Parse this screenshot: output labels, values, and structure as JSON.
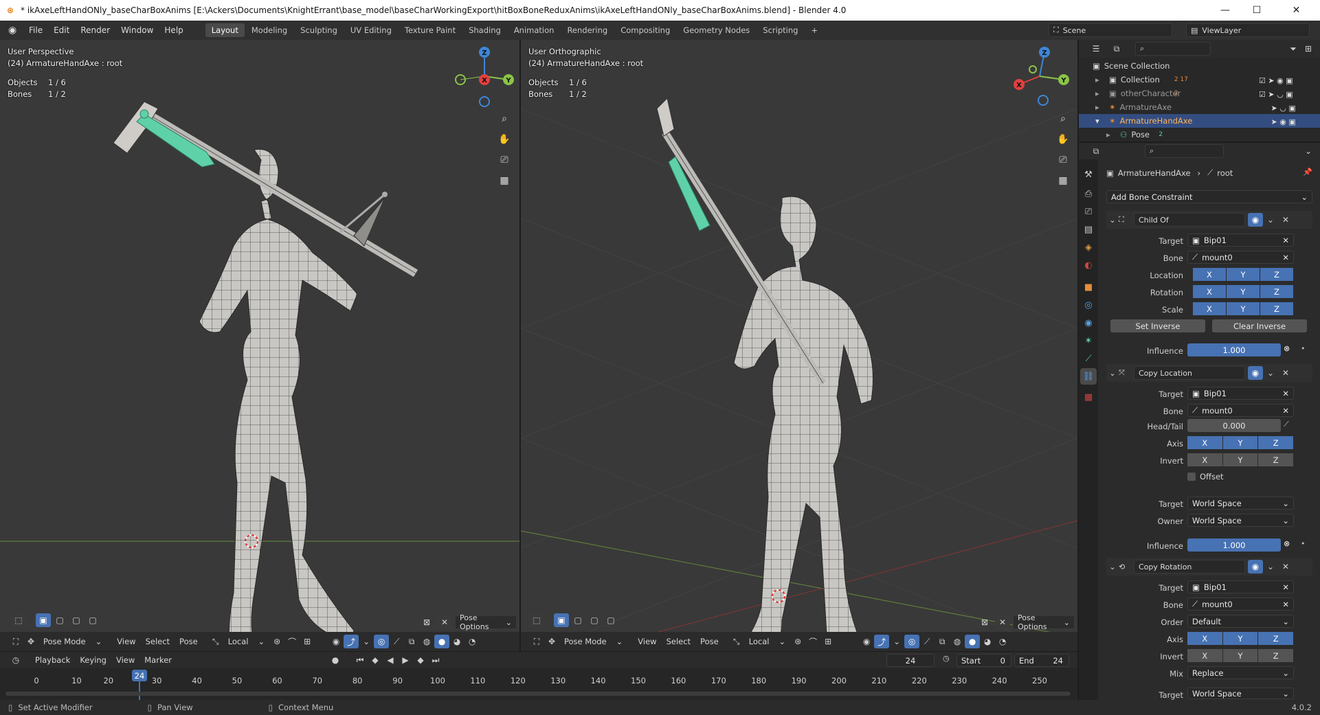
{
  "titlebar": {
    "title": "* ikAxeLeftHandONly_baseCharBoxAnims [E:\\Ackers\\Documents\\KnightErrant\\base_model\\baseCharWorkingExport\\hitBoxBoneReduxAnims\\ikAxeLeftHandONly_baseCharBoxAnims.blend] - Blender 4.0",
    "min": "—",
    "max": "☐",
    "close": "✕"
  },
  "menus": [
    "File",
    "Edit",
    "Render",
    "Window",
    "Help"
  ],
  "workspaces": [
    "Layout",
    "Modeling",
    "Sculpting",
    "UV Editing",
    "Texture Paint",
    "Shading",
    "Animation",
    "Rendering",
    "Compositing",
    "Geometry Nodes",
    "Scripting"
  ],
  "workspace_active": "Layout",
  "scene": {
    "name": "Scene",
    "viewlayer": "ViewLayer"
  },
  "viewport_left": {
    "view": "User Perspective",
    "object": "(24) ArmatureHandAxe : root",
    "objects_label": "Objects",
    "objects_val": "1 / 6",
    "bones_label": "Bones",
    "bones_val": "1 / 2"
  },
  "viewport_right": {
    "view": "User Orthographic",
    "object": "(24) ArmatureHandAxe : root",
    "objects_label": "Objects",
    "objects_val": "1 / 6",
    "bones_label": "Bones",
    "bones_val": "1 / 2"
  },
  "gizmo": {
    "x": "X",
    "y": "Y",
    "z": "Z"
  },
  "vp_header": {
    "mode": "Pose Mode",
    "view": "View",
    "select": "Select",
    "pose": "Pose",
    "orientation": "Local",
    "pose_options": "Pose Options"
  },
  "outliner": {
    "scene_collection": "Scene Collection",
    "rows": [
      {
        "name": "Collection",
        "badge": "2  17"
      },
      {
        "name": "otherCharacter",
        "badge": "2"
      },
      {
        "name": "ArmatureAxe",
        "badge": ""
      },
      {
        "name": "ArmatureHandAxe",
        "badge": ""
      },
      {
        "name": "Pose",
        "badge": "2"
      }
    ]
  },
  "properties": {
    "breadcrumb_object": "ArmatureHandAxe",
    "breadcrumb_bone": "root",
    "add_constraint": "Add Bone Constraint",
    "child_of": {
      "name": "Child Of",
      "target_label": "Target",
      "target": "Bip01",
      "bone_label": "Bone",
      "bone": "mount0",
      "location_label": "Location",
      "rotation_label": "Rotation",
      "scale_label": "Scale",
      "set_inverse": "Set Inverse",
      "clear_inverse": "Clear Inverse",
      "influence_label": "Influence",
      "influence": "1.000"
    },
    "copy_location": {
      "name": "Copy Location",
      "target_label": "Target",
      "target": "Bip01",
      "bone_label": "Bone",
      "bone": "mount0",
      "headtail_label": "Head/Tail",
      "headtail": "0.000",
      "axis_label": "Axis",
      "invert_label": "Invert",
      "offset": "Offset",
      "tspace_label": "Target",
      "tspace": "World Space",
      "ospace_label": "Owner",
      "ospace": "World Space",
      "influence_label": "Influence",
      "influence": "1.000"
    },
    "copy_rotation": {
      "name": "Copy Rotation",
      "target_label": "Target",
      "target": "Bip01",
      "bone_label": "Bone",
      "bone": "mount0",
      "order_label": "Order",
      "order": "Default",
      "axis_label": "Axis",
      "invert_label": "Invert",
      "mix_label": "Mix",
      "mix": "Replace",
      "tspace_label": "Target",
      "tspace": "World Space"
    },
    "x": "X",
    "y": "Y",
    "z": "Z"
  },
  "timeline": {
    "playback": "Playback",
    "keying": "Keying",
    "view": "View",
    "marker": "Marker",
    "current_frame": "24",
    "start_label": "Start",
    "start": "0",
    "end_label": "End",
    "end": "24",
    "ticks": [
      "0",
      "10",
      "20",
      "30",
      "40",
      "50",
      "60",
      "70",
      "80",
      "90",
      "100",
      "110",
      "120",
      "130",
      "140",
      "150",
      "160",
      "170",
      "180",
      "190",
      "200",
      "210",
      "220",
      "230",
      "240",
      "250"
    ]
  },
  "statusbar": {
    "left": "Set Active Modifier",
    "mid": "Pan View",
    "right": "Context Menu",
    "version": "4.0.2"
  },
  "colors": {
    "accent": "#4772b3",
    "bone_selected": "#5fd1a8",
    "x_axis": "#e2403f",
    "y_axis": "#8ac447",
    "z_axis": "#3e86d8"
  }
}
